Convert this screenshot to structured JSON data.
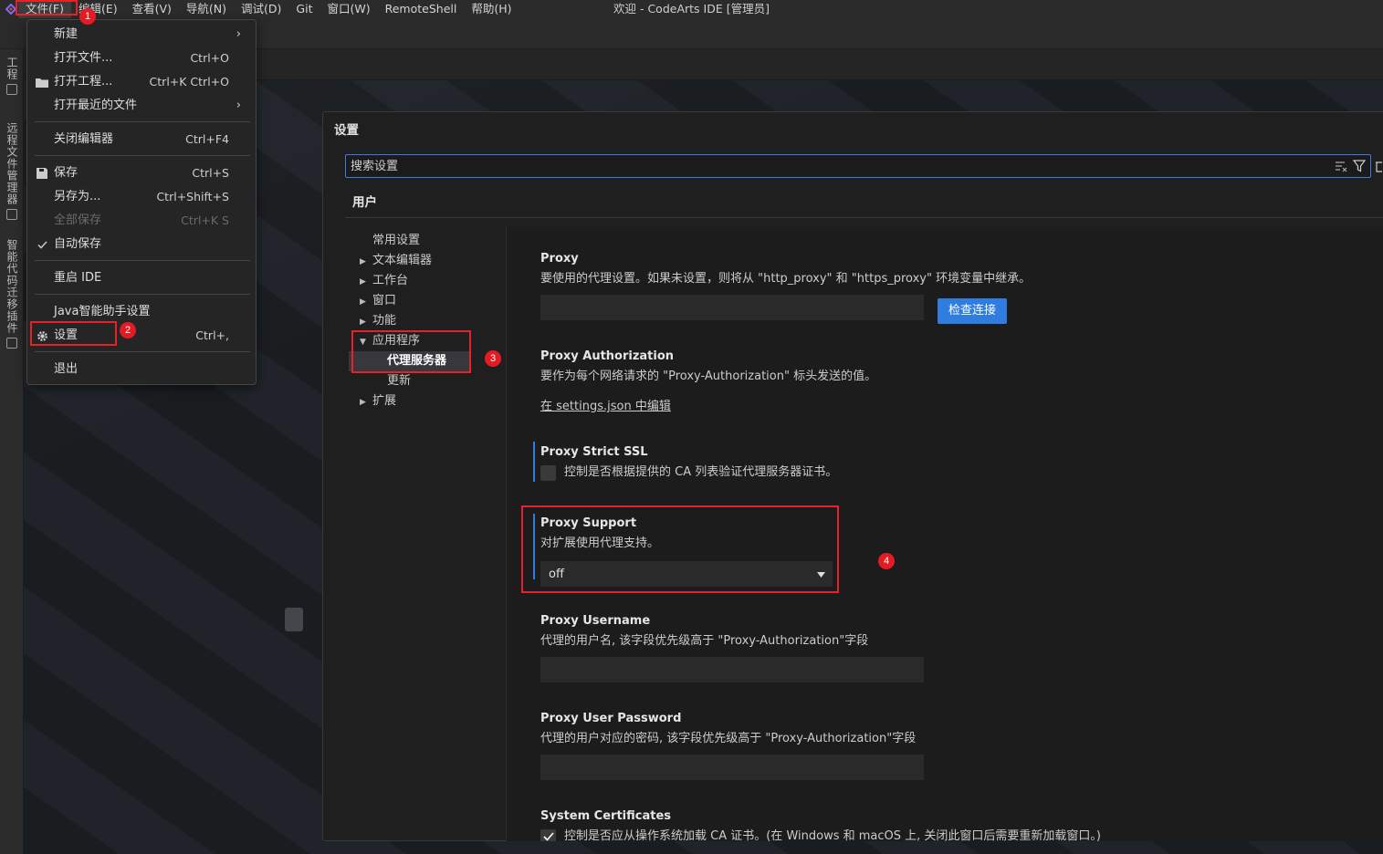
{
  "menubar": {
    "items": [
      "文件(F)",
      "编辑(E)",
      "查看(V)",
      "导航(N)",
      "调试(D)",
      "Git",
      "窗口(W)",
      "RemoteShell",
      "帮助(H)"
    ],
    "window_title": "欢迎 - CodeArts IDE [管理员]"
  },
  "activity_bar": {
    "items": [
      "工程",
      "远程文件管理器",
      "智能代码迁移插件"
    ]
  },
  "file_menu": {
    "new": "新建",
    "open_file": "打开文件...",
    "open_file_shortcut": "Ctrl+O",
    "open_project": "打开工程...",
    "open_project_shortcut": "Ctrl+K Ctrl+O",
    "open_recent": "打开最近的文件",
    "close_editor": "关闭编辑器",
    "close_editor_shortcut": "Ctrl+F4",
    "save": "保存",
    "save_shortcut": "Ctrl+S",
    "save_as": "另存为...",
    "save_as_shortcut": "Ctrl+Shift+S",
    "save_all": "全部保存",
    "save_all_shortcut": "Ctrl+K S",
    "auto_save": "自动保存",
    "restart": "重启 IDE",
    "java_assistant": "Java智能助手设置",
    "settings": "设置",
    "settings_shortcut": "Ctrl+,",
    "exit": "退出"
  },
  "settings": {
    "title": "设置",
    "search_placeholder": "搜索设置",
    "scope_tab": "用户",
    "toc": {
      "common": "常用设置",
      "text_editor": "文本编辑器",
      "workbench": "工作台",
      "window": "窗口",
      "features": "功能",
      "application": "应用程序",
      "proxy_server": "代理服务器",
      "update": "更新",
      "extensions": "扩展"
    },
    "items": {
      "proxy": {
        "title": "Proxy",
        "desc": "要使用的代理设置。如果未设置，则将从 \"http_proxy\" 和 \"https_proxy\" 环境变量中继承。",
        "value": "",
        "button": "检查连接"
      },
      "proxy_authorization": {
        "title": "Proxy Authorization",
        "desc": "要作为每个网络请求的 \"Proxy-Authorization\" 标头发送的值。",
        "link": "在 settings.json 中编辑"
      },
      "proxy_strict_ssl": {
        "title": "Proxy Strict SSL",
        "desc": "控制是否根据提供的 CA 列表验证代理服务器证书。",
        "checked": false
      },
      "proxy_support": {
        "title": "Proxy Support",
        "desc": "对扩展使用代理支持。",
        "value": "off"
      },
      "proxy_username": {
        "title": "Proxy Username",
        "desc": "代理的用户名, 该字段优先级高于 \"Proxy-Authorization\"字段",
        "value": ""
      },
      "proxy_user_password": {
        "title": "Proxy User Password",
        "desc": "代理的用户对应的密码, 该字段优先级高于 \"Proxy-Authorization\"字段",
        "value": ""
      },
      "system_certificates": {
        "title": "System Certificates",
        "desc": "控制是否应从操作系统加载 CA 证书。(在 Windows 和 macOS 上, 关闭此窗口后需要重新加载窗口。)",
        "checked": true
      }
    }
  },
  "annotations": {
    "badge_1": "1",
    "badge_2": "2",
    "badge_3": "3",
    "badge_4": "4",
    "color": "#e8202a"
  },
  "colors": {
    "accent": "#2f7de1",
    "menubar_bg": "#2b2b2b",
    "panel_bg": "#1f1f1f"
  }
}
